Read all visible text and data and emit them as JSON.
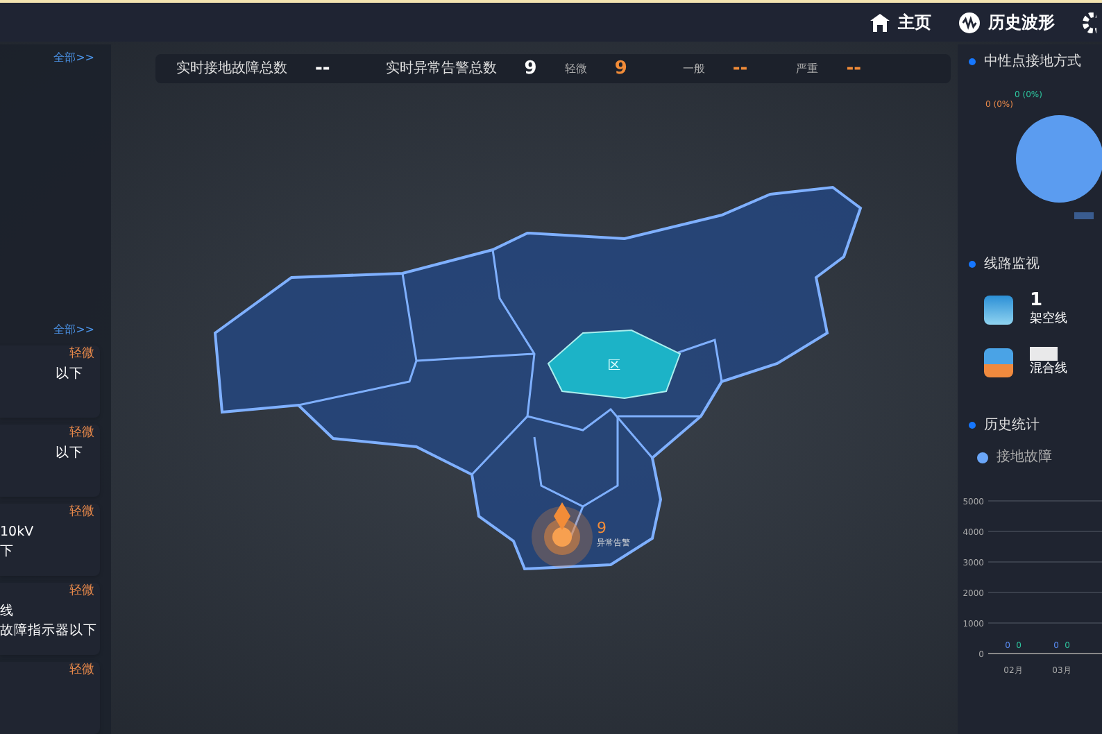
{
  "nav": [
    {
      "label": "主页"
    },
    {
      "label": "历史波形"
    }
  ],
  "left_panel": {
    "top_link": "全部>>",
    "alarm_link": "全部>>",
    "alarms": [
      {
        "level": "轻微",
        "lines": [
          "以下"
        ]
      },
      {
        "level": "轻微",
        "lines": [
          "以下"
        ]
      },
      {
        "level": "轻微",
        "lines": [
          "10kV",
          "下"
        ]
      },
      {
        "level": "轻微",
        "lines": [
          "线",
          "故障指示器以下"
        ]
      },
      {
        "level": "轻微"
      }
    ]
  },
  "summary": [
    {
      "label": "实时接地故障总数",
      "value": "--",
      "kind": "white"
    },
    {
      "label": "实时异常告警总数",
      "value": "9",
      "kind": "white"
    },
    {
      "label": "轻微",
      "value": "9",
      "kind": "orange"
    },
    {
      "label": "一般",
      "value": "--",
      "kind": "orange"
    },
    {
      "label": "严重",
      "value": "--",
      "kind": "orange"
    }
  ],
  "map": {
    "district_label": "区",
    "marker": {
      "count": "9",
      "label": "异常告警"
    }
  },
  "right_panel": {
    "grounding": {
      "title": "中性点接地方式",
      "pie_labels": [
        {
          "text": "0 (0%)",
          "color": "#2ec7a0"
        },
        {
          "text": "0 (0%)",
          "color": "#e8894a"
        }
      ]
    },
    "lines": {
      "title": "线路监视",
      "items": [
        {
          "value": "1",
          "label": "架空线"
        },
        {
          "label": "混合线"
        }
      ]
    },
    "history": {
      "title": "历史统计",
      "chart_data": {
        "type": "bar",
        "categories": [
          "02月",
          "03月"
        ],
        "series": [
          {
            "name": "接地故障",
            "color": "#5b8ff9",
            "values": [
              0,
              0
            ]
          },
          {
            "color": "#2ec7a0",
            "values": [
              0,
              0
            ]
          }
        ],
        "ylim": [
          0,
          5000
        ],
        "yticks": [
          0,
          1000,
          2000,
          3000,
          4000,
          5000
        ],
        "grid": true,
        "data_labels": true
      }
    }
  }
}
